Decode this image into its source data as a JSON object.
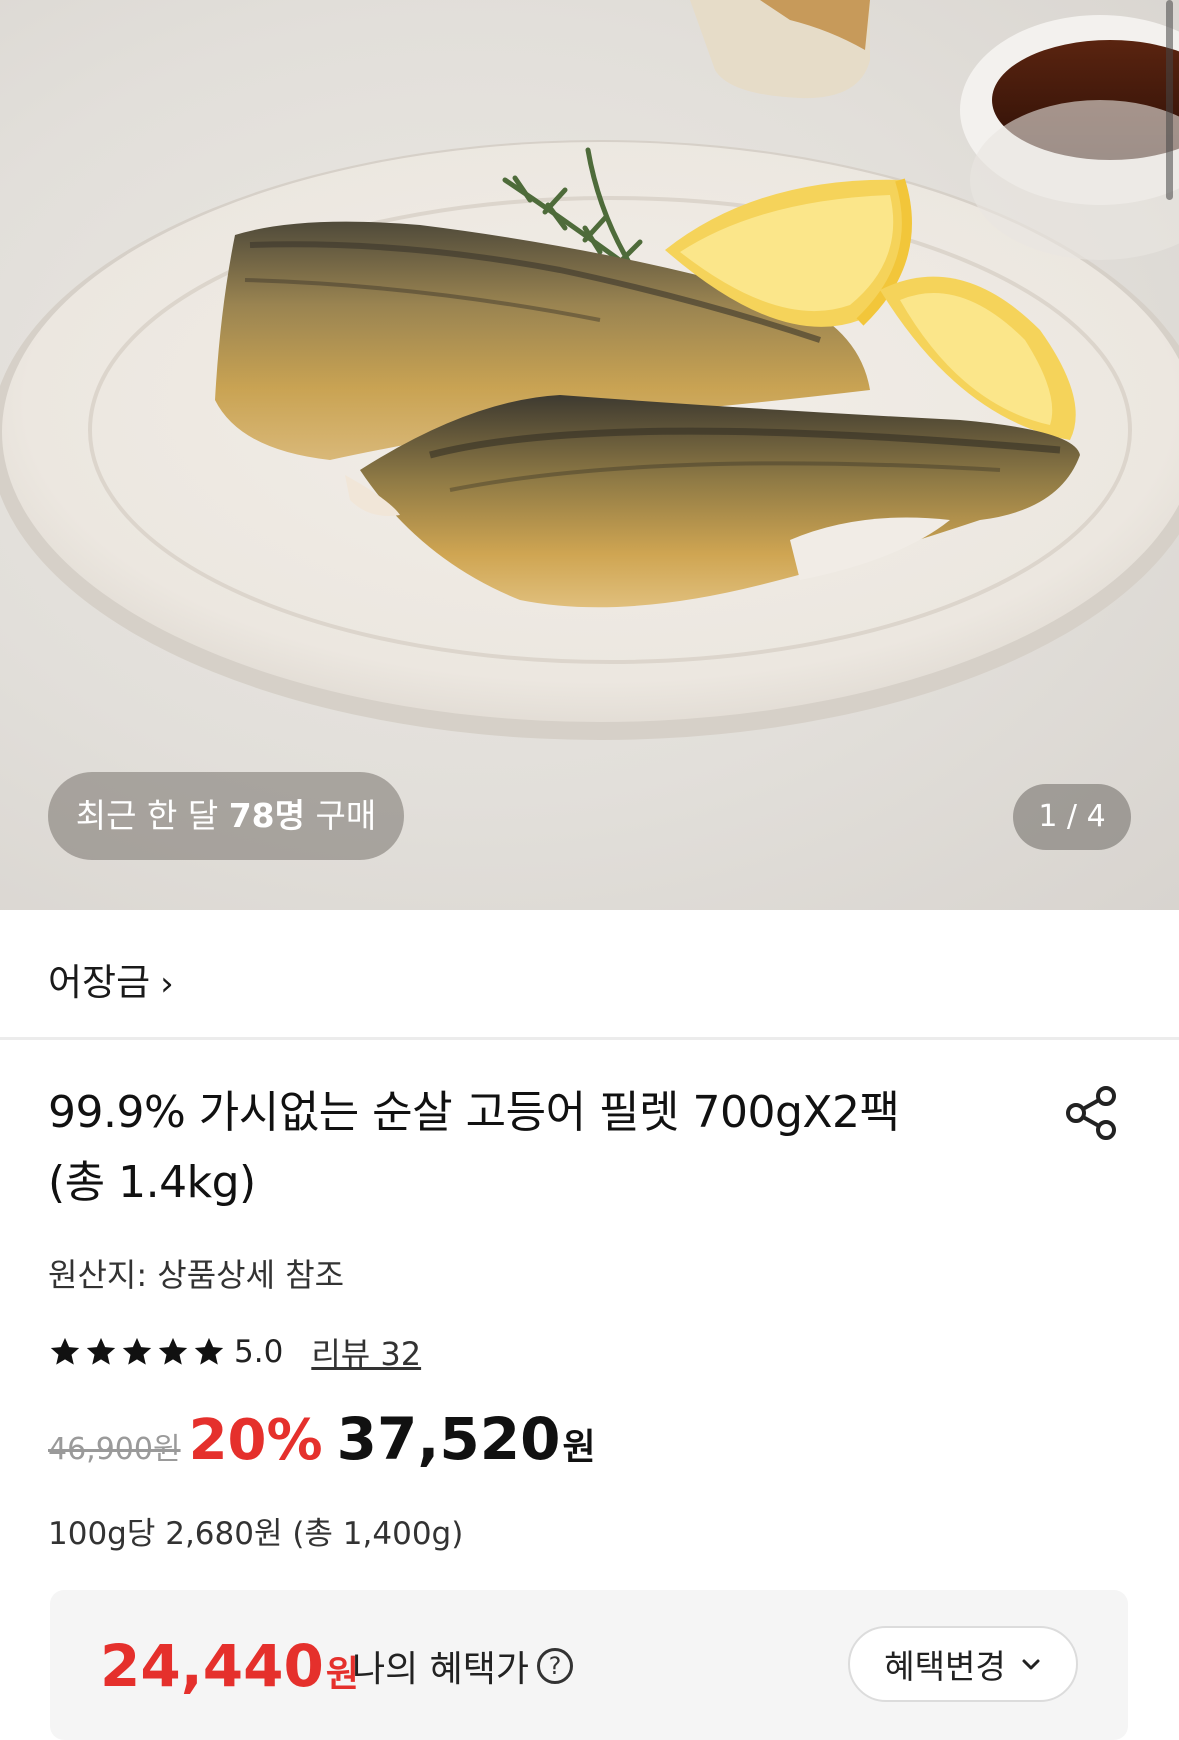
{
  "hero": {
    "image_alt": "grilled mackerel fillets on an oval plate with lemon wedges and rosemary",
    "purchase_prefix": "최근 한 달 ",
    "purchase_count": "78명",
    "purchase_suffix": " 구매",
    "page_counter": "1 / 4"
  },
  "store": {
    "name": "어장금",
    "chevron": "›"
  },
  "product": {
    "title_line1": "99.9% 가시없는 순살 고등어 필렛 700gX2팩",
    "title_line2": "(총 1.4kg)",
    "origin": "원산지: 상품상세 참조",
    "rating": "5.0",
    "rating_stars": 5,
    "review_link": "리뷰 32",
    "original_price": "46,900원",
    "discount": "20%",
    "final_price": "37,520",
    "final_unit": "원",
    "unit_price": "100g당 2,680원 (총 1,400g)"
  },
  "benefit": {
    "price": "24,440",
    "unit": "원",
    "label": "나의 혜택가",
    "help_glyph": "?",
    "change_button": "혜택변경"
  },
  "icons": {
    "share": "share-icon",
    "star": "star-icon",
    "help": "help-icon",
    "chevron": "chevron-down-icon"
  },
  "colors": {
    "accent_red": "#e5302c",
    "text_dark": "#111111",
    "muted": "#9a9a9a"
  }
}
